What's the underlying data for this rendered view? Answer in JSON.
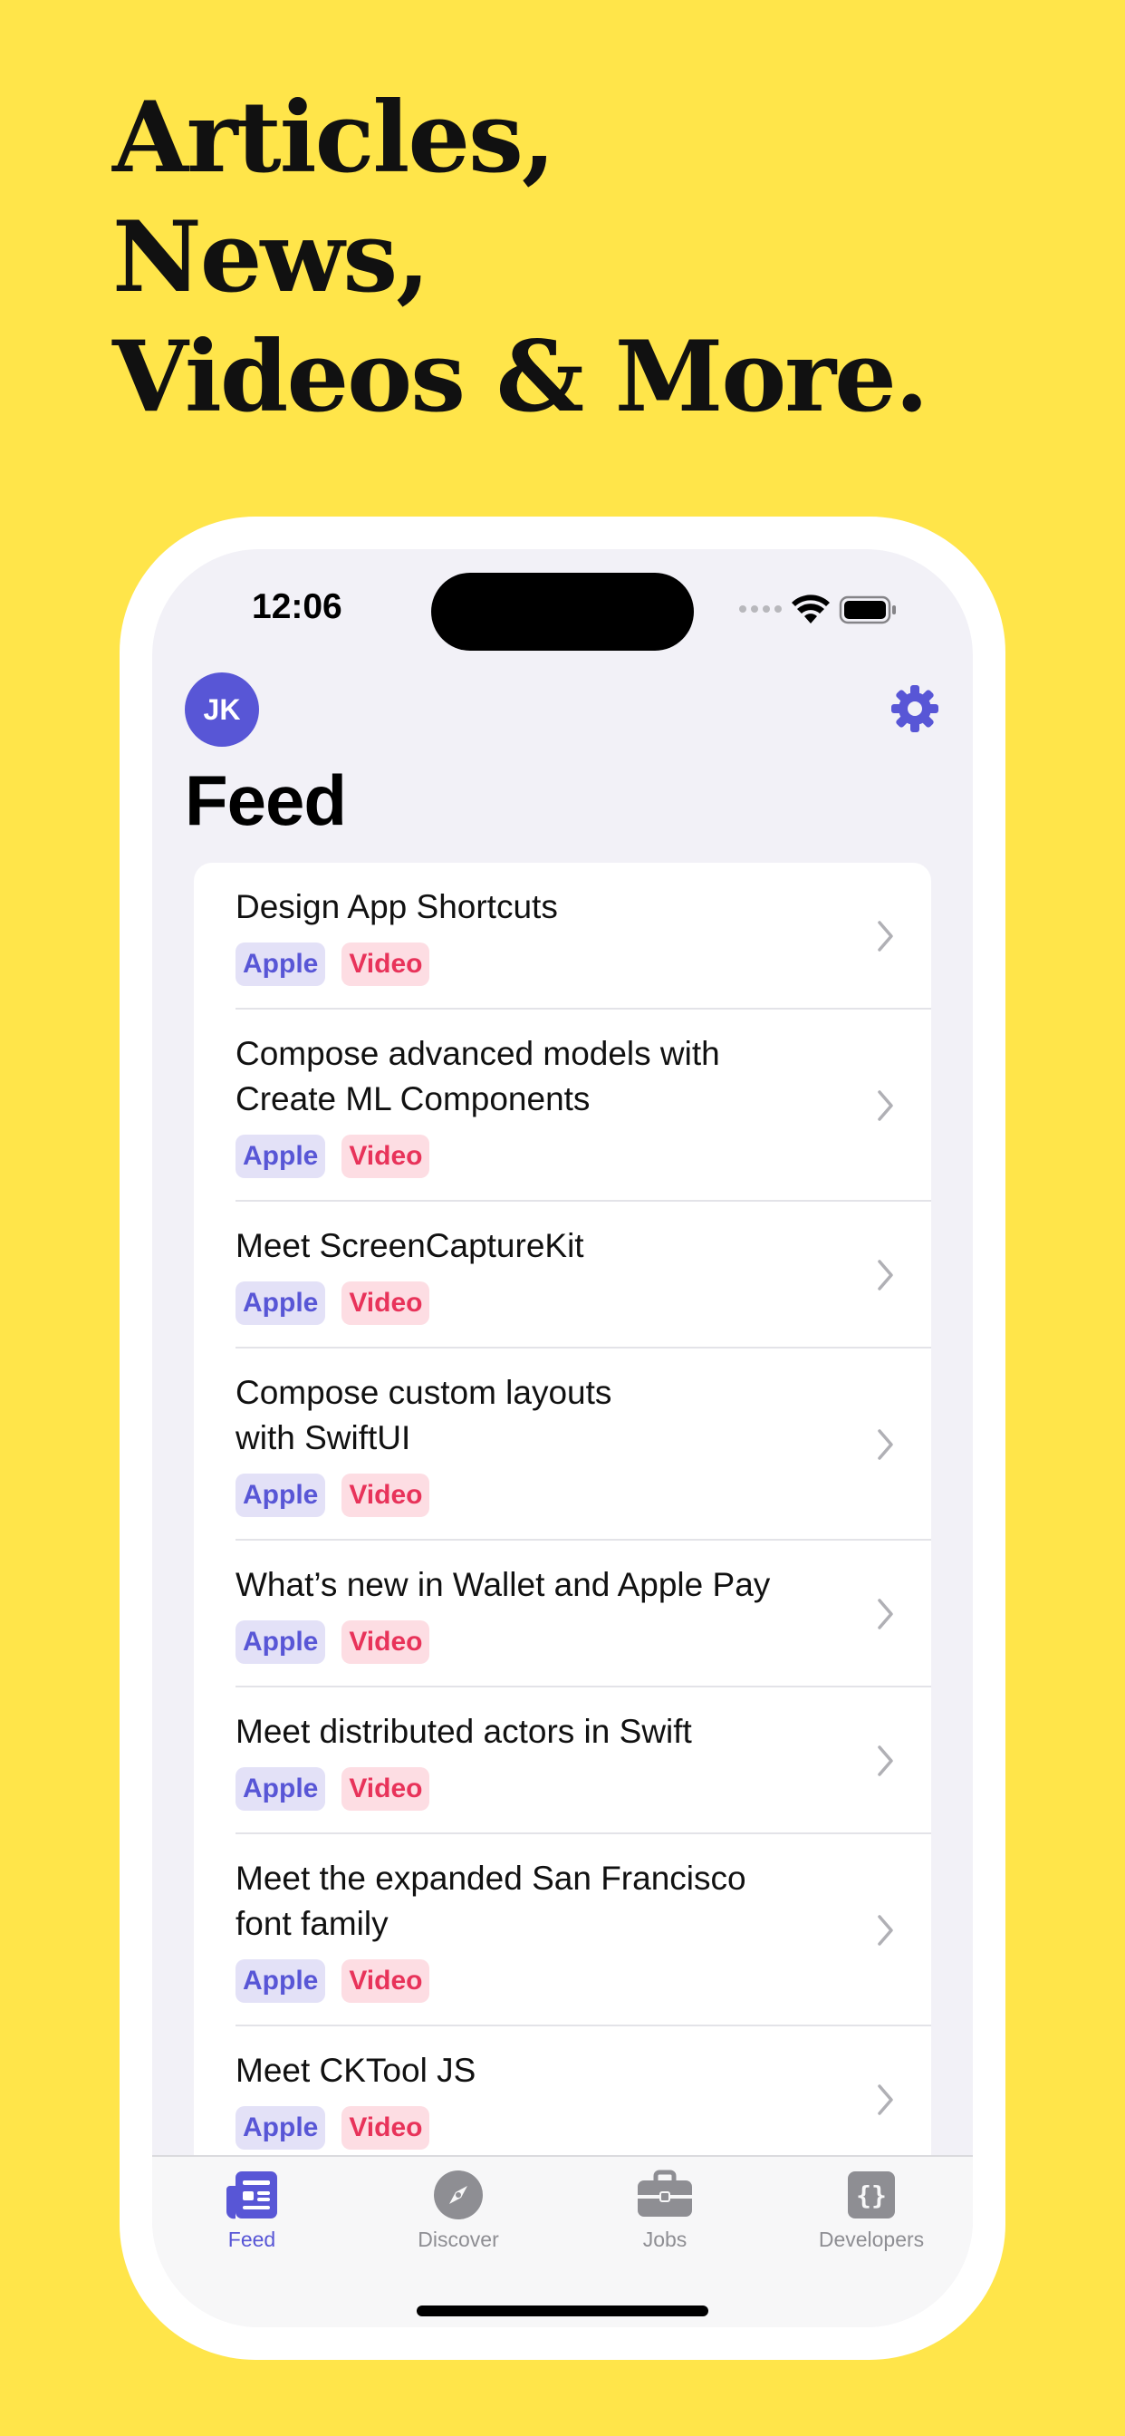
{
  "headline": [
    "Articles,",
    "News,",
    "Videos & More."
  ],
  "status_bar": {
    "time": "12:06"
  },
  "header": {
    "avatar_initials": "JK",
    "title": "Feed"
  },
  "feed": {
    "items": [
      {
        "title_lines": [
          "Design App Shortcuts"
        ],
        "tags": [
          "Apple",
          "Video"
        ]
      },
      {
        "title_lines": [
          "Compose advanced models with",
          "Create ML Components"
        ],
        "tags": [
          "Apple",
          "Video"
        ]
      },
      {
        "title_lines": [
          "Meet ScreenCaptureKit"
        ],
        "tags": [
          "Apple",
          "Video"
        ]
      },
      {
        "title_lines": [
          "Compose custom layouts",
          "with SwiftUI"
        ],
        "tags": [
          "Apple",
          "Video"
        ]
      },
      {
        "title_lines": [
          "What’s new in Wallet and Apple Pay"
        ],
        "tags": [
          "Apple",
          "Video"
        ]
      },
      {
        "title_lines": [
          "Meet distributed actors in Swift"
        ],
        "tags": [
          "Apple",
          "Video"
        ]
      },
      {
        "title_lines": [
          "Meet the expanded San Francisco",
          "font family"
        ],
        "tags": [
          "Apple",
          "Video"
        ]
      },
      {
        "title_lines": [
          "Meet CKTool JS"
        ],
        "tags": [
          "Apple",
          "Video"
        ]
      }
    ]
  },
  "tabbar": {
    "tabs": [
      {
        "label": "Feed",
        "icon": "newspaper-icon",
        "active": true
      },
      {
        "label": "Discover",
        "icon": "compass-icon",
        "active": false
      },
      {
        "label": "Jobs",
        "icon": "briefcase-icon",
        "active": false
      },
      {
        "label": "Developers",
        "icon": "curly-braces-icon",
        "active": false
      }
    ]
  },
  "colors": {
    "background": "#FFE54A",
    "accent": "#5856D6",
    "video_tag": "#E8335A"
  }
}
